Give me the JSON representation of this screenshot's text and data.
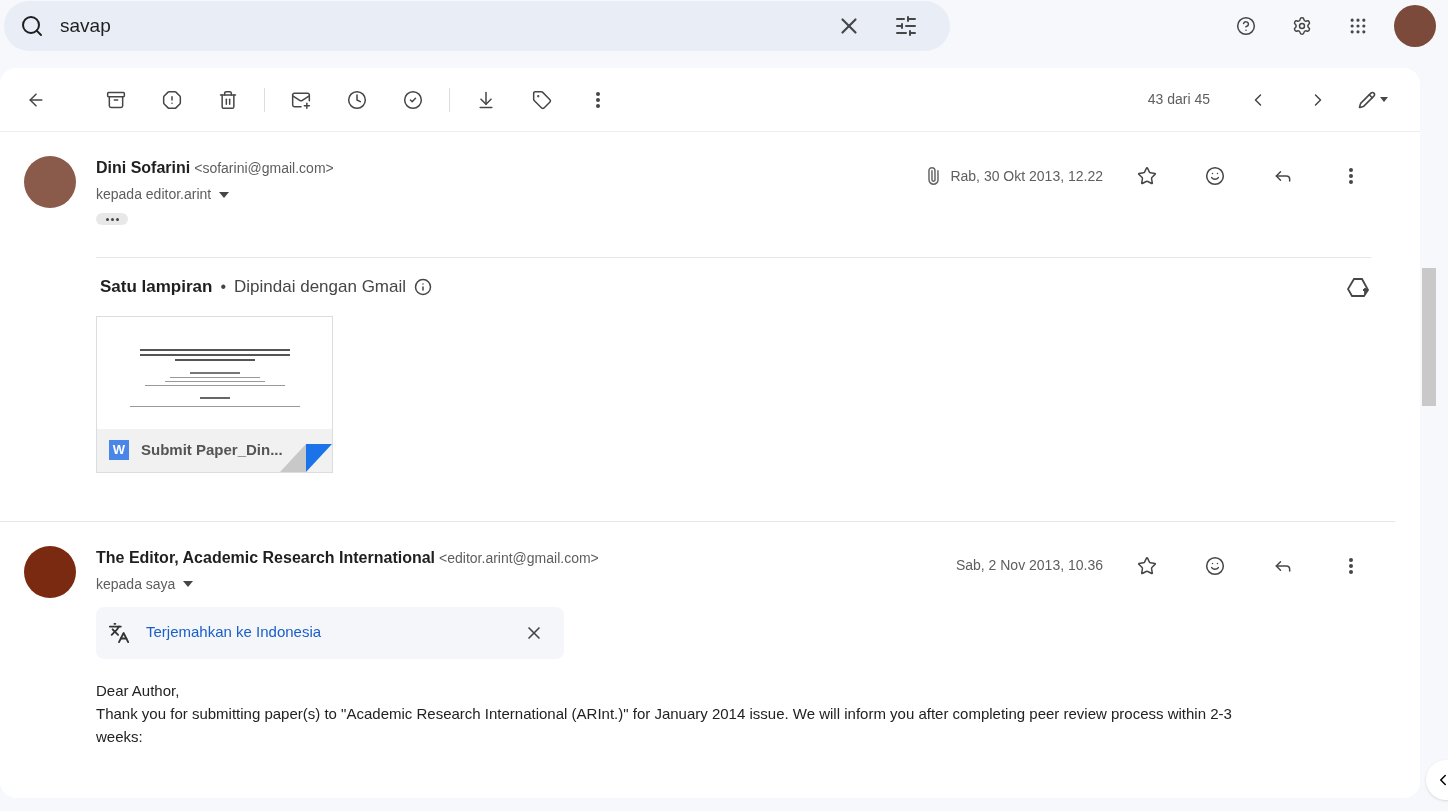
{
  "search": {
    "value": "savap"
  },
  "toolbar": {
    "counter": "43 dari 45"
  },
  "messages": [
    {
      "sender": "Dini Sofarini",
      "email": "<sofarini@gmail.com>",
      "recipient": "kepada editor.arint",
      "date": "Rab, 30 Okt 2013, 12.22",
      "has_attachment_icon": true,
      "collapsed_quote": true,
      "attachments": {
        "title": "Satu lampiran",
        "separator": "•",
        "scan_note": "Dipindai dengan Gmail",
        "files": [
          {
            "name": "Submit Paper_Din...",
            "badge": "W"
          }
        ]
      }
    },
    {
      "sender": "The Editor, Academic Research International",
      "email": "<editor.arint@gmail.com>",
      "recipient": "kepada saya",
      "date": "Sab, 2 Nov 2013, 10.36",
      "has_attachment_icon": false,
      "collapsed_quote": false,
      "translate": {
        "label": "Terjemahkan ke Indonesia"
      },
      "body": [
        "Dear Author,",
        "Thank you for submitting paper(s) to \"Academic Research International (ARInt.)\" for January 2014 issue. We will inform you after completing peer review process within 2-3 weeks:"
      ]
    }
  ]
}
